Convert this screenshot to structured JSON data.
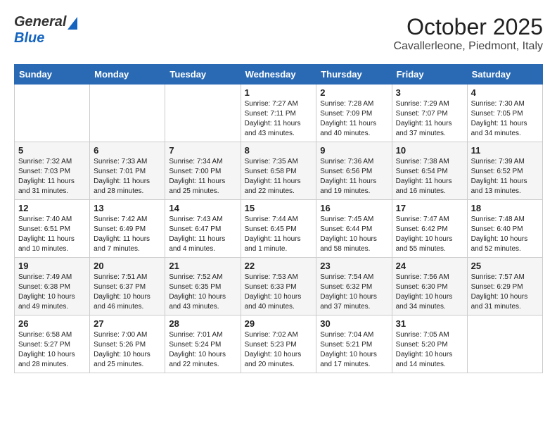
{
  "header": {
    "logo_general": "General",
    "logo_blue": "Blue",
    "month_title": "October 2025",
    "location": "Cavallerleone, Piedmont, Italy"
  },
  "weekdays": [
    "Sunday",
    "Monday",
    "Tuesday",
    "Wednesday",
    "Thursday",
    "Friday",
    "Saturday"
  ],
  "weeks": [
    [
      {
        "day": "",
        "info": ""
      },
      {
        "day": "",
        "info": ""
      },
      {
        "day": "",
        "info": ""
      },
      {
        "day": "1",
        "info": "Sunrise: 7:27 AM\nSunset: 7:11 PM\nDaylight: 11 hours\nand 43 minutes."
      },
      {
        "day": "2",
        "info": "Sunrise: 7:28 AM\nSunset: 7:09 PM\nDaylight: 11 hours\nand 40 minutes."
      },
      {
        "day": "3",
        "info": "Sunrise: 7:29 AM\nSunset: 7:07 PM\nDaylight: 11 hours\nand 37 minutes."
      },
      {
        "day": "4",
        "info": "Sunrise: 7:30 AM\nSunset: 7:05 PM\nDaylight: 11 hours\nand 34 minutes."
      }
    ],
    [
      {
        "day": "5",
        "info": "Sunrise: 7:32 AM\nSunset: 7:03 PM\nDaylight: 11 hours\nand 31 minutes."
      },
      {
        "day": "6",
        "info": "Sunrise: 7:33 AM\nSunset: 7:01 PM\nDaylight: 11 hours\nand 28 minutes."
      },
      {
        "day": "7",
        "info": "Sunrise: 7:34 AM\nSunset: 7:00 PM\nDaylight: 11 hours\nand 25 minutes."
      },
      {
        "day": "8",
        "info": "Sunrise: 7:35 AM\nSunset: 6:58 PM\nDaylight: 11 hours\nand 22 minutes."
      },
      {
        "day": "9",
        "info": "Sunrise: 7:36 AM\nSunset: 6:56 PM\nDaylight: 11 hours\nand 19 minutes."
      },
      {
        "day": "10",
        "info": "Sunrise: 7:38 AM\nSunset: 6:54 PM\nDaylight: 11 hours\nand 16 minutes."
      },
      {
        "day": "11",
        "info": "Sunrise: 7:39 AM\nSunset: 6:52 PM\nDaylight: 11 hours\nand 13 minutes."
      }
    ],
    [
      {
        "day": "12",
        "info": "Sunrise: 7:40 AM\nSunset: 6:51 PM\nDaylight: 11 hours\nand 10 minutes."
      },
      {
        "day": "13",
        "info": "Sunrise: 7:42 AM\nSunset: 6:49 PM\nDaylight: 11 hours\nand 7 minutes."
      },
      {
        "day": "14",
        "info": "Sunrise: 7:43 AM\nSunset: 6:47 PM\nDaylight: 11 hours\nand 4 minutes."
      },
      {
        "day": "15",
        "info": "Sunrise: 7:44 AM\nSunset: 6:45 PM\nDaylight: 11 hours\nand 1 minute."
      },
      {
        "day": "16",
        "info": "Sunrise: 7:45 AM\nSunset: 6:44 PM\nDaylight: 10 hours\nand 58 minutes."
      },
      {
        "day": "17",
        "info": "Sunrise: 7:47 AM\nSunset: 6:42 PM\nDaylight: 10 hours\nand 55 minutes."
      },
      {
        "day": "18",
        "info": "Sunrise: 7:48 AM\nSunset: 6:40 PM\nDaylight: 10 hours\nand 52 minutes."
      }
    ],
    [
      {
        "day": "19",
        "info": "Sunrise: 7:49 AM\nSunset: 6:38 PM\nDaylight: 10 hours\nand 49 minutes."
      },
      {
        "day": "20",
        "info": "Sunrise: 7:51 AM\nSunset: 6:37 PM\nDaylight: 10 hours\nand 46 minutes."
      },
      {
        "day": "21",
        "info": "Sunrise: 7:52 AM\nSunset: 6:35 PM\nDaylight: 10 hours\nand 43 minutes."
      },
      {
        "day": "22",
        "info": "Sunrise: 7:53 AM\nSunset: 6:33 PM\nDaylight: 10 hours\nand 40 minutes."
      },
      {
        "day": "23",
        "info": "Sunrise: 7:54 AM\nSunset: 6:32 PM\nDaylight: 10 hours\nand 37 minutes."
      },
      {
        "day": "24",
        "info": "Sunrise: 7:56 AM\nSunset: 6:30 PM\nDaylight: 10 hours\nand 34 minutes."
      },
      {
        "day": "25",
        "info": "Sunrise: 7:57 AM\nSunset: 6:29 PM\nDaylight: 10 hours\nand 31 minutes."
      }
    ],
    [
      {
        "day": "26",
        "info": "Sunrise: 6:58 AM\nSunset: 5:27 PM\nDaylight: 10 hours\nand 28 minutes."
      },
      {
        "day": "27",
        "info": "Sunrise: 7:00 AM\nSunset: 5:26 PM\nDaylight: 10 hours\nand 25 minutes."
      },
      {
        "day": "28",
        "info": "Sunrise: 7:01 AM\nSunset: 5:24 PM\nDaylight: 10 hours\nand 22 minutes."
      },
      {
        "day": "29",
        "info": "Sunrise: 7:02 AM\nSunset: 5:23 PM\nDaylight: 10 hours\nand 20 minutes."
      },
      {
        "day": "30",
        "info": "Sunrise: 7:04 AM\nSunset: 5:21 PM\nDaylight: 10 hours\nand 17 minutes."
      },
      {
        "day": "31",
        "info": "Sunrise: 7:05 AM\nSunset: 5:20 PM\nDaylight: 10 hours\nand 14 minutes."
      },
      {
        "day": "",
        "info": ""
      }
    ]
  ]
}
